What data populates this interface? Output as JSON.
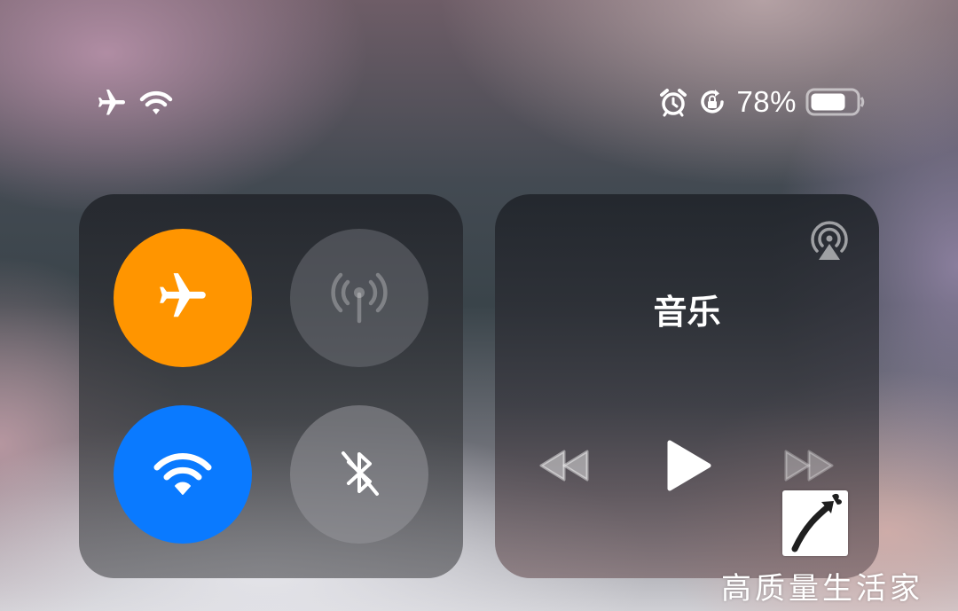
{
  "status_bar": {
    "battery_percent": "78%",
    "battery_level": 0.78,
    "left_icons": [
      "airplane-icon",
      "wifi-icon"
    ],
    "right_icons": [
      "alarm-icon",
      "rotation-lock-icon",
      "battery-icon"
    ]
  },
  "connectivity": {
    "airplane_mode": {
      "icon": "airplane-icon",
      "state": "on",
      "color": "#ff9500"
    },
    "cellular_data": {
      "icon": "cellular-antenna-icon",
      "state": "disabled"
    },
    "wifi": {
      "icon": "wifi-icon",
      "state": "on",
      "color": "#0a7aff"
    },
    "bluetooth": {
      "icon": "bluetooth-off-icon",
      "state": "off"
    }
  },
  "music": {
    "title": "音乐",
    "airplay_icon": "airplay-audio-icon",
    "controls": [
      "rewind-icon",
      "play-icon",
      "fast-forward-icon"
    ]
  },
  "watermark": {
    "text": "高质量生活家",
    "logo": "butterfly-arrow-logo"
  }
}
